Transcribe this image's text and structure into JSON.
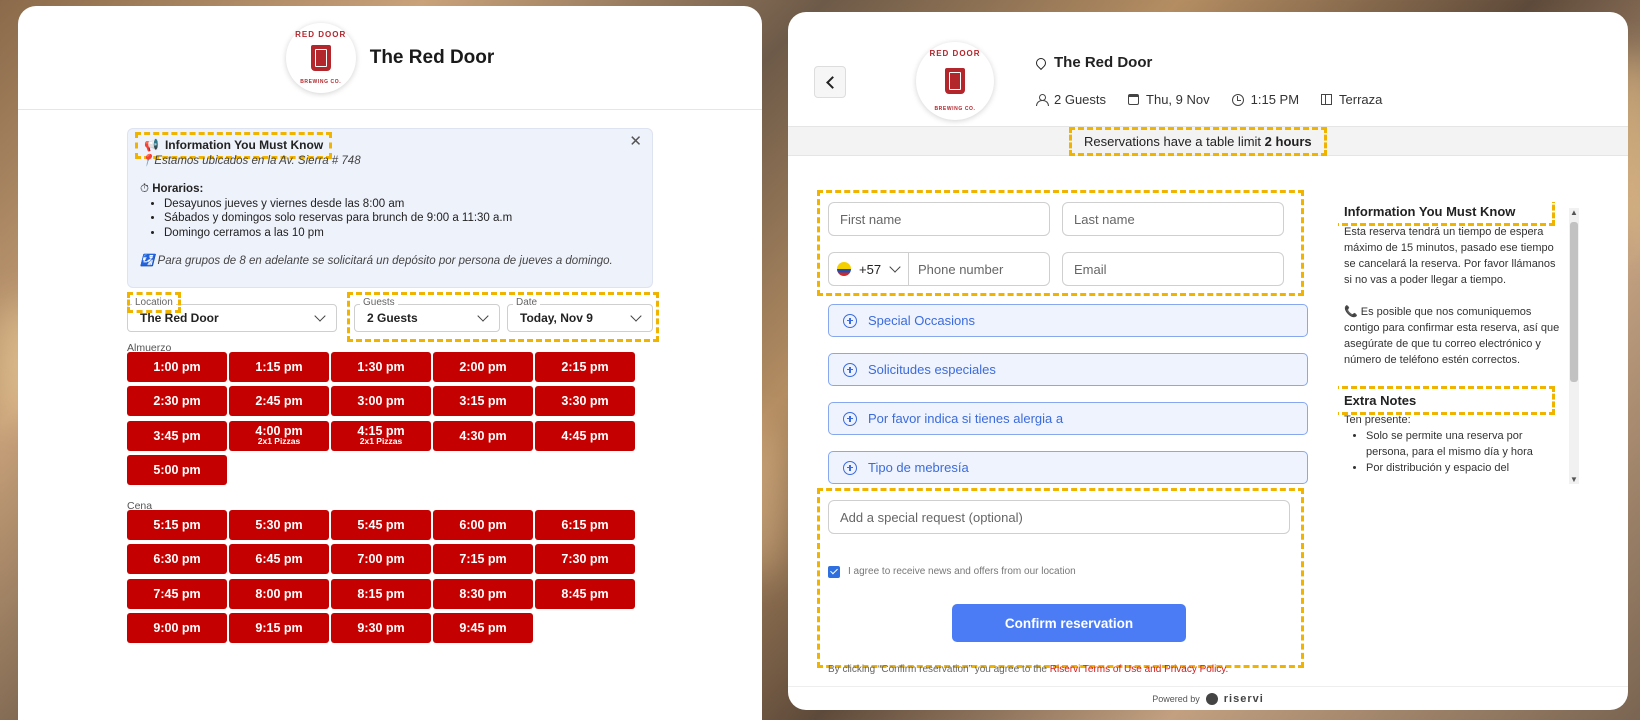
{
  "restaurant_name": "The Red Door",
  "logo": {
    "top_text": "RED DOOR",
    "bottom_text": "BREWING CO."
  },
  "left": {
    "info": {
      "title": "Information You Must Know",
      "title_icon": "📢",
      "close_glyph": "✕",
      "address": "📍Estamos ubicados en la Av. Sierra # 748",
      "hours_title": "Horarios:",
      "hours_icon": "⏱",
      "hours": [
        "Desayunos jueves y viernes desde las 8:00 am",
        "Sábados y domingos solo reservas para brunch de 9:00 a 11:30 a.m",
        "Domingo cerramos a las 10 pm"
      ],
      "group_icon": "🛂",
      "group_note": "Para grupos de 8 en adelante se solicitará un depósito por persona de jueves a domingo."
    },
    "location": {
      "label": "Location",
      "value": "The Red Door"
    },
    "guests": {
      "label": "Guests",
      "value": "2 Guests"
    },
    "date": {
      "label": "Date",
      "value": "Today, Nov 9"
    },
    "almuerzo": {
      "label": "Almuerzo",
      "slots": [
        {
          "time": "1:00 pm",
          "promo": ""
        },
        {
          "time": "1:15 pm",
          "promo": ""
        },
        {
          "time": "1:30 pm",
          "promo": ""
        },
        {
          "time": "2:00 pm",
          "promo": ""
        },
        {
          "time": "2:15 pm",
          "promo": ""
        },
        {
          "time": "2:30 pm",
          "promo": ""
        },
        {
          "time": "2:45 pm",
          "promo": ""
        },
        {
          "time": "3:00 pm",
          "promo": ""
        },
        {
          "time": "3:15 pm",
          "promo": ""
        },
        {
          "time": "3:30 pm",
          "promo": ""
        },
        {
          "time": "3:45 pm",
          "promo": ""
        },
        {
          "time": "4:00 pm",
          "promo": "2x1 Pizzas"
        },
        {
          "time": "4:15 pm",
          "promo": "2x1 Pizzas"
        },
        {
          "time": "4:30 pm",
          "promo": ""
        },
        {
          "time": "4:45 pm",
          "promo": ""
        },
        {
          "time": "5:00 pm",
          "promo": ""
        }
      ]
    },
    "cena": {
      "label": "Cena",
      "slots": [
        {
          "time": "5:15 pm",
          "promo": ""
        },
        {
          "time": "5:30 pm",
          "promo": ""
        },
        {
          "time": "5:45 pm",
          "promo": ""
        },
        {
          "time": "6:00 pm",
          "promo": ""
        },
        {
          "time": "6:15 pm",
          "promo": ""
        },
        {
          "time": "6:30 pm",
          "promo": ""
        },
        {
          "time": "6:45 pm",
          "promo": ""
        },
        {
          "time": "7:00 pm",
          "promo": ""
        },
        {
          "time": "7:15 pm",
          "promo": ""
        },
        {
          "time": "7:30 pm",
          "promo": ""
        },
        {
          "time": "7:45 pm",
          "promo": ""
        },
        {
          "time": "8:00 pm",
          "promo": ""
        },
        {
          "time": "8:15 pm",
          "promo": ""
        },
        {
          "time": "8:30 pm",
          "promo": ""
        },
        {
          "time": "8:45 pm",
          "promo": ""
        },
        {
          "time": "9:00 pm",
          "promo": ""
        },
        {
          "time": "9:15 pm",
          "promo": ""
        },
        {
          "time": "9:30 pm",
          "promo": ""
        },
        {
          "time": "9:45 pm",
          "promo": ""
        }
      ]
    }
  },
  "right": {
    "booking": {
      "guests": "2 Guests",
      "date": "Thu, 9 Nov",
      "time": "1:15 PM",
      "area": "Terraza"
    },
    "table_limit_prefix": "Reservations have a table limit",
    "table_limit_value": "2 hours",
    "form": {
      "first_name_placeholder": "First name",
      "last_name_placeholder": "Last name",
      "country_code": "+57",
      "phone_placeholder": "Phone number",
      "email_placeholder": "Email",
      "accordions": [
        "Special Occasions",
        "Solicitudes especiales",
        "Por favor indica si tienes alergia a",
        "Tipo de mebresía"
      ],
      "special_request_placeholder": "Add a special request (optional)",
      "news_consent": "I agree to receive news and offers from our location",
      "confirm_label": "Confirm reservation",
      "terms_prefix": "By clicking “Confirm reservation” you agree to the",
      "terms_link": "Riservi Terms of Use and Privacy Policy."
    },
    "side": {
      "info_title": "Information You Must Know",
      "info_lines": [
        "Esta reserva tendrá un tiempo de espera máximo de 15 minutos, pasado ese tiempo se cancelará la reserva. Por favor llámanos si no vas a poder llegar a tiempo.",
        "📞 Es posible que nos comuniquemos contigo para confirmar esta reserva, así que asegúrate de que tu correo electrónico y número de teléfono estén correctos."
      ],
      "notes_title": "Extra Notes",
      "notes_intro": "Ten presente:",
      "notes_items": [
        "Solo se permite una reserva por persona, para el mismo día y hora",
        "Por distribución y espacio del"
      ]
    },
    "powered_by": "Powered by",
    "powered_brand": "riservi"
  },
  "colors": {
    "slot_red": "#c50000",
    "accent_blue": "#4b7cf5",
    "highlight": "#f0b400",
    "info_bg": "#eef2fb"
  }
}
